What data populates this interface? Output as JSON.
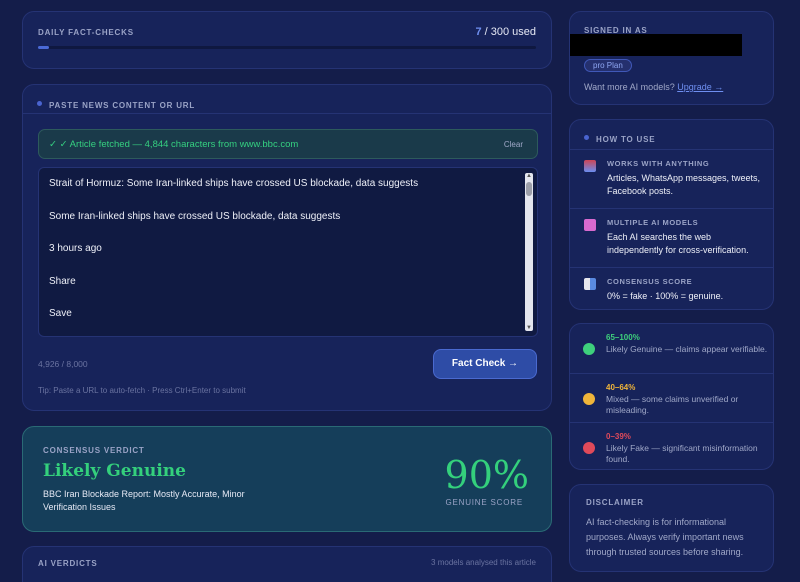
{
  "daily": {
    "label": "DAILY FACT-CHECKS",
    "used_count": "7",
    "used_rest": " / 300 used",
    "progress_fraction": 0.023
  },
  "paste": {
    "label": "PASTE NEWS CONTENT OR URL",
    "fetched_msg": "✓ ✓ Article fetched — 4,844 characters from www.bbc.com",
    "clear_label": "Clear",
    "lines": [
      "Strait of Hormuz: Some Iran-linked ships have crossed US blockade, data suggests",
      "Some Iran-linked ships have crossed US blockade, data suggests",
      "3 hours ago",
      "Share",
      "Save"
    ],
    "counter": "4,926 / 8,000",
    "button": "Fact Check →",
    "tip": "Tip: Paste a URL to auto-fetch · Press Ctrl+Enter to submit"
  },
  "verdict": {
    "label": "CONSENSUS VERDICT",
    "title": "Likely Genuine",
    "desc": "BBC Iran Blockade Report: Mostly Accurate, Minor Verification Issues",
    "score": "90%",
    "score_label": "GENUINE SCORE"
  },
  "ai_verdicts": {
    "label": "AI VERDICTS",
    "meta": "3 models analysed this article"
  },
  "signed": {
    "label": "SIGNED IN AS",
    "plan": "pro Plan",
    "more_text": "Want more AI models? ",
    "upgrade": "Upgrade →"
  },
  "howto": {
    "label": "HOW TO USE",
    "items": [
      {
        "title": "WORKS WITH ANYTHING",
        "desc": "Articles, WhatsApp messages, tweets, Facebook posts.",
        "icon": "phone-icon"
      },
      {
        "title": "MULTIPLE AI MODELS",
        "desc": "Each AI searches the web independently for cross-verification.",
        "icon": "robot-icon"
      },
      {
        "title": "CONSENSUS SCORE",
        "desc": "0% = fake · 100% = genuine.",
        "icon": "chart-icon"
      }
    ]
  },
  "legend": [
    {
      "range": "65–100%",
      "desc": "Likely Genuine — claims appear verifiable.",
      "color": "#3ed07c"
    },
    {
      "range": "40–64%",
      "desc": "Mixed — some claims unverified or misleading.",
      "color": "#f0b53a"
    },
    {
      "range": "0–39%",
      "desc": "Likely Fake — significant misinformation found.",
      "color": "#e04a5a"
    }
  ],
  "disclaimer": {
    "label": "DISCLAIMER",
    "text": "AI fact-checking is for informational purposes. Always verify important news through trusted sources before sharing."
  }
}
